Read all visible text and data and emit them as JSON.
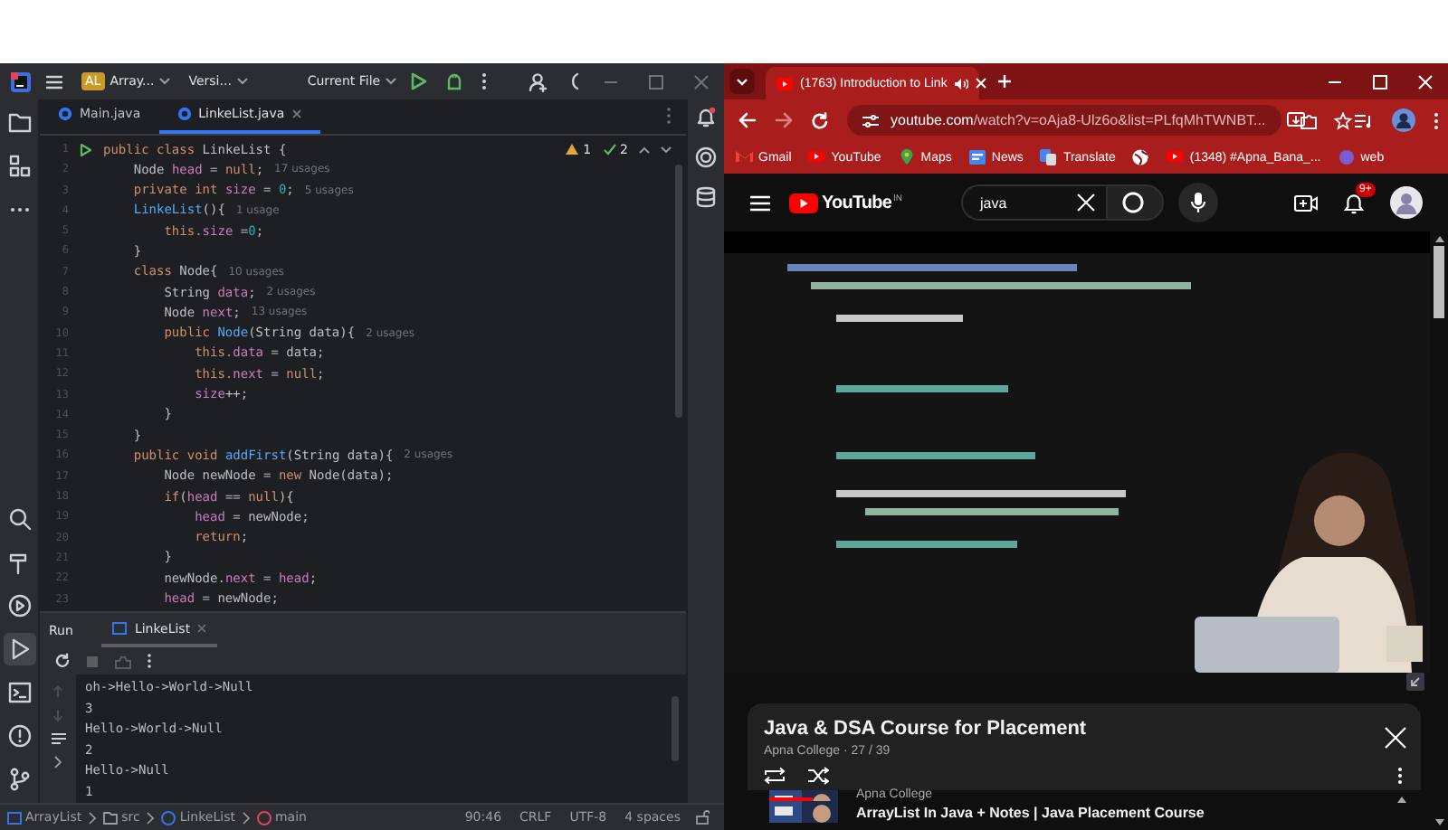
{
  "ide": {
    "toolbar": {
      "project_badge": "AL",
      "project": "Array...",
      "vcs": "Versi...",
      "run_config": "Current File"
    },
    "tool_strip": [
      {
        "selected": false
      },
      {
        "selected": false
      },
      {
        "selected": false
      },
      {
        "selected": false
      },
      {
        "selected": false
      },
      {
        "selected": false
      },
      {
        "selected": true
      },
      {
        "selected": false
      },
      {
        "selected": false
      },
      {
        "selected": false
      }
    ],
    "tabs": [
      {
        "label": "Main.java",
        "selected": false
      },
      {
        "label": "LinkeList.java",
        "selected": true
      }
    ],
    "inspections": {
      "warnings": "1",
      "checks": "2"
    },
    "code": [
      {
        "number": "1",
        "run": true,
        "tokens": [
          {
            "kind": "kw",
            "text": "public class "
          },
          {
            "kind": "plain",
            "text": "LinkeList {"
          }
        ]
      },
      {
        "number": "2",
        "tokens": [
          {
            "kind": "plain",
            "text": "    Node "
          },
          {
            "kind": "field",
            "text": "head"
          },
          {
            "kind": "plain",
            "text": " = "
          },
          {
            "kind": "kw",
            "text": "null"
          },
          {
            "kind": "plain",
            "text": ";"
          }
        ],
        "hint": "17 usages"
      },
      {
        "number": "3",
        "tokens": [
          {
            "kind": "kw",
            "text": "    private int "
          },
          {
            "kind": "field",
            "text": "size"
          },
          {
            "kind": "plain",
            "text": " = "
          },
          {
            "kind": "num",
            "text": "0"
          },
          {
            "kind": "plain",
            "text": ";"
          }
        ],
        "hint": "5 usages"
      },
      {
        "number": "4",
        "tokens": [
          {
            "kind": "fn",
            "text": "    LinkeList"
          },
          {
            "kind": "plain",
            "text": "(){"
          }
        ],
        "hint": "1 usage"
      },
      {
        "number": "5",
        "tokens": [
          {
            "kind": "kw",
            "text": "        this."
          },
          {
            "kind": "field",
            "text": "size"
          },
          {
            "kind": "plain",
            "text": " ="
          },
          {
            "kind": "num",
            "text": "0"
          },
          {
            "kind": "plain",
            "text": ";"
          }
        ]
      },
      {
        "number": "6",
        "tokens": [
          {
            "kind": "plain",
            "text": "    }"
          }
        ]
      },
      {
        "number": "7",
        "tokens": [
          {
            "kind": "kw",
            "text": "    class "
          },
          {
            "kind": "plain",
            "text": "Node{"
          }
        ],
        "hint": "10 usages"
      },
      {
        "number": "8",
        "tokens": [
          {
            "kind": "plain",
            "text": "        String "
          },
          {
            "kind": "field",
            "text": "data"
          },
          {
            "kind": "plain",
            "text": ";"
          }
        ],
        "hint": "2 usages"
      },
      {
        "number": "9",
        "tokens": [
          {
            "kind": "plain",
            "text": "        Node "
          },
          {
            "kind": "field",
            "text": "next"
          },
          {
            "kind": "plain",
            "text": ";"
          }
        ],
        "hint": "13 usages"
      },
      {
        "number": "10",
        "tokens": [
          {
            "kind": "kw",
            "text": "        public "
          },
          {
            "kind": "fn",
            "text": "Node"
          },
          {
            "kind": "plain",
            "text": "(String data){"
          }
        ],
        "hint": "2 usages"
      },
      {
        "number": "11",
        "tokens": [
          {
            "kind": "kw",
            "text": "            this."
          },
          {
            "kind": "field",
            "text": "data"
          },
          {
            "kind": "plain",
            "text": " = data;"
          }
        ]
      },
      {
        "number": "12",
        "tokens": [
          {
            "kind": "kw",
            "text": "            this."
          },
          {
            "kind": "field",
            "text": "next"
          },
          {
            "kind": "plain",
            "text": " = "
          },
          {
            "kind": "kw",
            "text": "null"
          },
          {
            "kind": "plain",
            "text": ";"
          }
        ]
      },
      {
        "number": "13",
        "tokens": [
          {
            "kind": "field",
            "text": "            size"
          },
          {
            "kind": "plain",
            "text": "++;"
          }
        ]
      },
      {
        "number": "14",
        "tokens": [
          {
            "kind": "plain",
            "text": "        }"
          }
        ]
      },
      {
        "number": "15",
        "tokens": [
          {
            "kind": "plain",
            "text": "    }"
          }
        ]
      },
      {
        "number": "16",
        "tokens": [
          {
            "kind": "kw",
            "text": "    public void "
          },
          {
            "kind": "fn",
            "text": "addFirst"
          },
          {
            "kind": "plain",
            "text": "(String data){"
          }
        ],
        "hint": "2 usages"
      },
      {
        "number": "17",
        "tokens": [
          {
            "kind": "plain",
            "text": "        Node newNode = "
          },
          {
            "kind": "kw",
            "text": "new "
          },
          {
            "kind": "plain",
            "text": "Node(data);"
          }
        ]
      },
      {
        "number": "18",
        "tokens": [
          {
            "kind": "kw",
            "text": "        if"
          },
          {
            "kind": "plain",
            "text": "("
          },
          {
            "kind": "field",
            "text": "head"
          },
          {
            "kind": "plain",
            "text": " == "
          },
          {
            "kind": "kw",
            "text": "null"
          },
          {
            "kind": "plain",
            "text": "){"
          }
        ]
      },
      {
        "number": "19",
        "tokens": [
          {
            "kind": "field",
            "text": "            head"
          },
          {
            "kind": "plain",
            "text": " = newNode;"
          }
        ]
      },
      {
        "number": "20",
        "tokens": [
          {
            "kind": "kw",
            "text": "            return"
          },
          {
            "kind": "plain",
            "text": ";"
          }
        ]
      },
      {
        "number": "21",
        "tokens": [
          {
            "kind": "plain",
            "text": "        }"
          }
        ]
      },
      {
        "number": "22",
        "tokens": [
          {
            "kind": "plain",
            "text": "        newNode."
          },
          {
            "kind": "field",
            "text": "next"
          },
          {
            "kind": "plain",
            "text": " = "
          },
          {
            "kind": "field",
            "text": "head"
          },
          {
            "kind": "plain",
            "text": ";"
          }
        ]
      },
      {
        "number": "23",
        "tokens": [
          {
            "kind": "field",
            "text": "        head"
          },
          {
            "kind": "plain",
            "text": " = newNode;"
          }
        ]
      }
    ],
    "run_panel": {
      "title": "Run",
      "tabs": [
        {
          "label": "LinkeList",
          "selected": true
        }
      ],
      "output": [
        "oh->Hello->World->Null",
        "3",
        "Hello->World->Null",
        "2",
        "Hello->Null",
        "1"
      ]
    },
    "status_bar": {
      "breadcrumbs": [
        {
          "kind": "module",
          "label": "ArrayList"
        },
        {
          "kind": "folder",
          "label": "src"
        },
        {
          "kind": "class",
          "label": "LinkeList"
        },
        {
          "kind": "method",
          "label": "main"
        }
      ],
      "position": "90:46",
      "line_separator": "CRLF",
      "encoding": "UTF-8",
      "indent": "4 spaces"
    }
  },
  "browser": {
    "tabs": [
      {
        "title": "(1763) Introduction to Link",
        "selected": true,
        "audio": true
      }
    ],
    "url": {
      "host": "youtube.com",
      "path": "/watch?v=oAja8-Ulz6o&list=PLfqMhTWNBT..."
    },
    "bookmarks": [
      {
        "kind": "gmail",
        "label": "Gmail"
      },
      {
        "kind": "youtube",
        "label": "YouTube"
      },
      {
        "kind": "maps",
        "label": "Maps"
      },
      {
        "kind": "news",
        "label": "News"
      },
      {
        "kind": "translate",
        "label": "Translate"
      },
      {
        "kind": "globe"
      },
      {
        "kind": "youtube",
        "label": "(1348) #Apna_Bana_..."
      },
      {
        "kind": "folder",
        "label": "web"
      }
    ],
    "youtube": {
      "logo": "YouTube",
      "region": "IN",
      "search": "java",
      "notifications": "9+"
    },
    "playlist": {
      "title": "Java & DSA Course for Placement",
      "channel": "Apna College · 27 / 39",
      "items": [
        {
          "channel": "Apna College"
        },
        {
          "title": "ArrayList In Java + Notes | Java Placement Course"
        }
      ]
    }
  }
}
